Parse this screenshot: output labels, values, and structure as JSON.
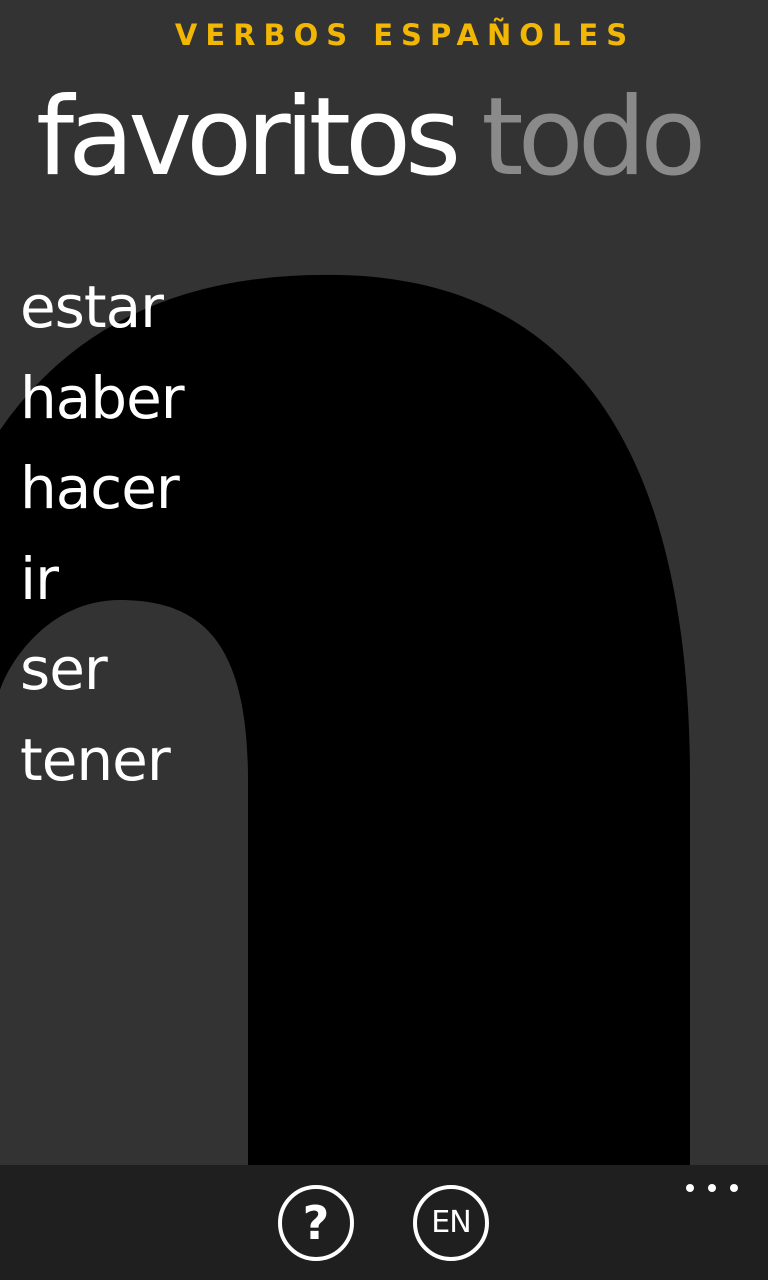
{
  "app": {
    "title": "VERBOS ESPAÑOLES",
    "accent_color": "#f2b705"
  },
  "pivot": {
    "tabs": [
      {
        "label": "favoritos",
        "active": true
      },
      {
        "label": "todo",
        "active": false
      }
    ]
  },
  "favorites": {
    "items": [
      "estar",
      "haber",
      "hacer",
      "ir",
      "ser",
      "tener"
    ]
  },
  "background": {
    "watermark_icon": "letter-n-watermark-icon"
  },
  "app_bar": {
    "help": {
      "icon": "question-mark-icon",
      "glyph": "?"
    },
    "language": {
      "label": "EN"
    },
    "more": {
      "icon": "ellipsis-icon"
    }
  }
}
